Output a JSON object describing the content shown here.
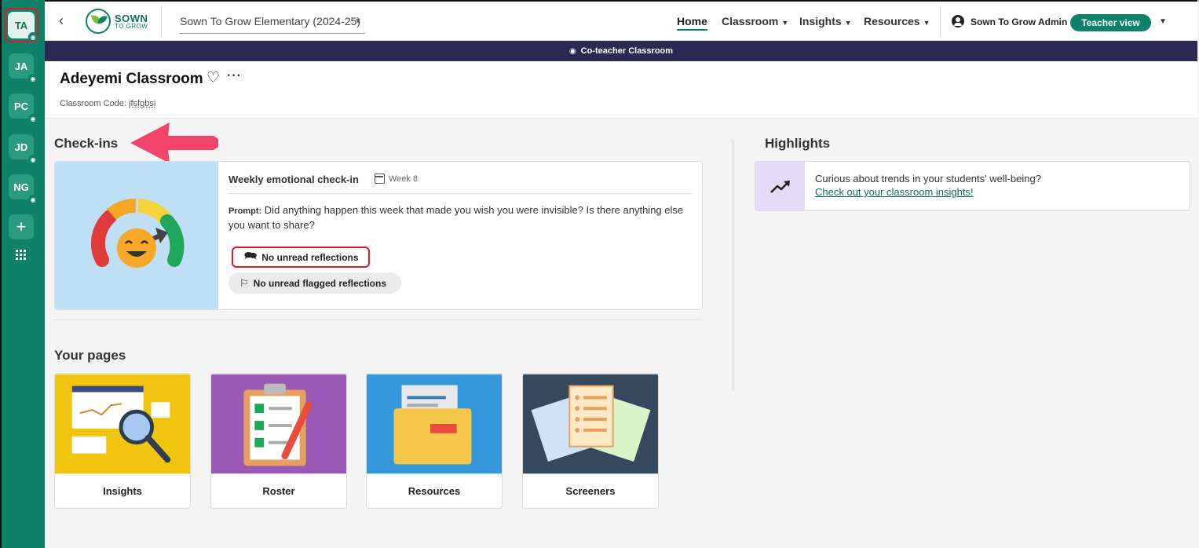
{
  "rail": {
    "items": [
      {
        "initials": "TA"
      },
      {
        "initials": "JA"
      },
      {
        "initials": "PC"
      },
      {
        "initials": "JD"
      },
      {
        "initials": "NG"
      }
    ],
    "add_label": "+"
  },
  "topbar": {
    "logo_line1": "SOWN",
    "logo_line2": "TO GROW",
    "school": "Sown To Grow Elementary (2024-25)",
    "nav": {
      "home": "Home",
      "classroom": "Classroom",
      "insights": "Insights",
      "resources": "Resources"
    },
    "user_name": "Sown To Grow Admin",
    "teacher_view": "Teacher view"
  },
  "banner": {
    "text": "Co-teacher Classroom"
  },
  "header": {
    "title": "Adeyemi Classroom",
    "code_label": "Classroom Code:",
    "code_value": "jfsfgbsi"
  },
  "checkins": {
    "section_title": "Check-ins",
    "card": {
      "title": "Weekly emotional check-in",
      "week": "Week 8",
      "prompt_label": "Prompt:",
      "prompt_text": "Did anything happen this week that made you wish you were invisible? Is there anything else you want to share?",
      "unread": "No unread reflections",
      "flagged": "No unread flagged reflections"
    }
  },
  "highlights": {
    "section_title": "Highlights",
    "text": "Curious about trends in your students' well-being?",
    "link": "Check out your classroom insights!"
  },
  "pages": {
    "section_title": "Your pages",
    "items": [
      {
        "label": "Insights",
        "color": "#f1c40f"
      },
      {
        "label": "Roster",
        "color": "#9b59b6"
      },
      {
        "label": "Resources",
        "color": "#3498db"
      },
      {
        "label": "Screeners",
        "color": "#34495e"
      }
    ]
  },
  "colors": {
    "brand": "#0e8269",
    "banner": "#2c2a52",
    "annotation": "#e01b24",
    "arrow": "#f2446d"
  }
}
